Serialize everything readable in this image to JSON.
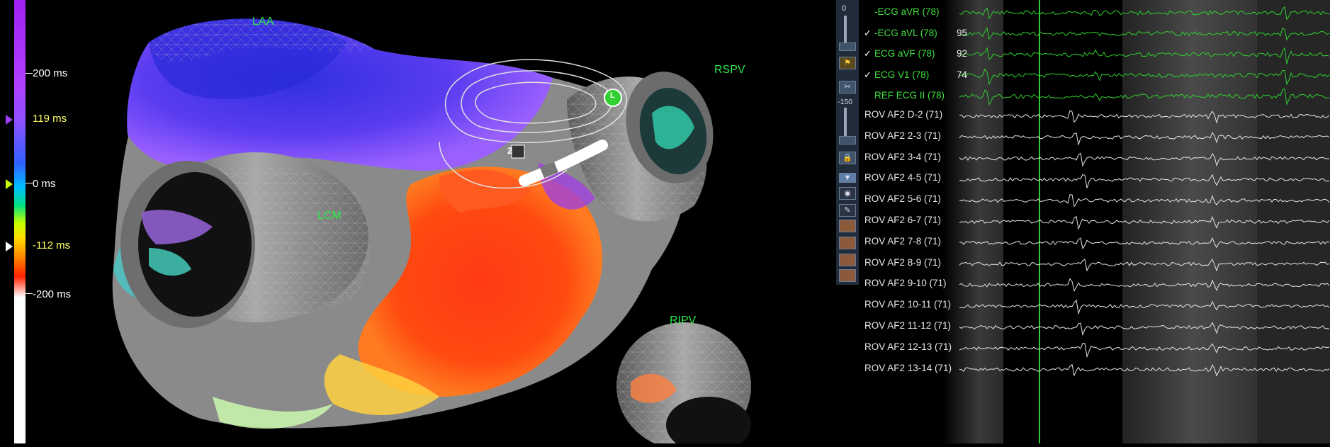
{
  "scale": {
    "labels": [
      {
        "text": "200 ms",
        "color": "#ffffff"
      },
      {
        "text": "119 ms",
        "color": "#ffff66"
      },
      {
        "text": "0 ms",
        "color": "#ffffff"
      },
      {
        "text": "-112 ms",
        "color": "#ffff66"
      },
      {
        "text": "-200 ms",
        "color": "#ffffff"
      }
    ]
  },
  "map": {
    "labels": [
      "LAA",
      "RSPV",
      "LCM",
      "RIPV"
    ],
    "catheter_electrode_label": "2",
    "catheter_tip_label": "L"
  },
  "toolbar": {
    "top_value": "0",
    "mid_value": "-150",
    "icons": [
      "slider-icon",
      "flag-icon",
      "scissors-icon",
      "lock-icon",
      "dropdown-icon",
      "eye-icon",
      "catheter-icon",
      "torso-front-icon",
      "torso-side-icon",
      "torso-back-icon",
      "torso-oblique-icon"
    ]
  },
  "ecg_channels": [
    {
      "label": "-ECG aVR (78)",
      "value": "",
      "checked": false
    },
    {
      "label": "-ECG aVL (78)",
      "value": "95",
      "checked": true
    },
    {
      "label": "ECG aVF (78)",
      "value": "92",
      "checked": true
    },
    {
      "label": "ECG V1 (78)",
      "value": "74",
      "checked": true
    },
    {
      "label": "REF ECG II (78)",
      "value": "",
      "checked": false
    }
  ],
  "egm_channels": [
    {
      "label": "ROV AF2   D-2 (71)"
    },
    {
      "label": "ROV AF2   2-3 (71)"
    },
    {
      "label": "ROV AF2   3-4 (71)"
    },
    {
      "label": "ROV AF2   4-5 (71)"
    },
    {
      "label": "ROV AF2   5-6 (71)"
    },
    {
      "label": "ROV AF2   6-7 (71)"
    },
    {
      "label": "ROV AF2   7-8 (71)"
    },
    {
      "label": "ROV AF2   8-9 (71)"
    },
    {
      "label": "ROV AF2   9-10 (71)"
    },
    {
      "label": "ROV AF2   10-11 (71)"
    },
    {
      "label": "ROV AF2   11-12 (71)"
    },
    {
      "label": "ROV AF2   12-13 (71)"
    },
    {
      "label": "ROV AF2   13-14 (71)"
    }
  ],
  "colors": {
    "ecg_trace": "#2fd02f",
    "egm_trace": "#e6e6e6",
    "vessel_label": "#2ee64a",
    "scale_highlight": "#ffff66",
    "marker_line": "#33cc33"
  }
}
